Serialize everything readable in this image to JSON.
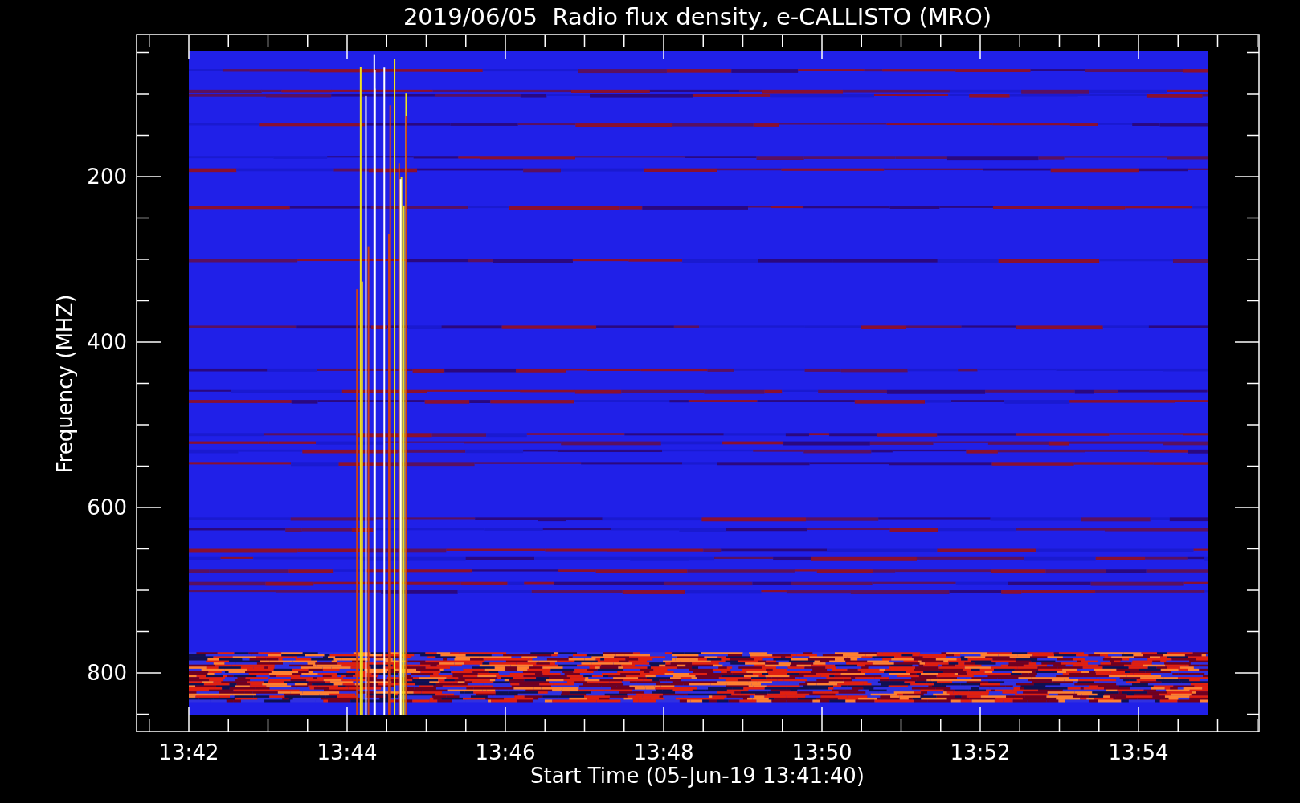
{
  "title": "2019/06/05  Radio flux density, e-CALLISTO (MRO)",
  "y_axis": {
    "label": "Frequency (MHZ)",
    "ticks": [
      "200",
      "400",
      "600",
      "800"
    ]
  },
  "x_axis": {
    "label": "Start Time (05-Jun-19 13:41:40)",
    "ticks": [
      "13:42",
      "13:44",
      "13:46",
      "13:48",
      "13:50",
      "13:52",
      "13:54"
    ]
  }
}
